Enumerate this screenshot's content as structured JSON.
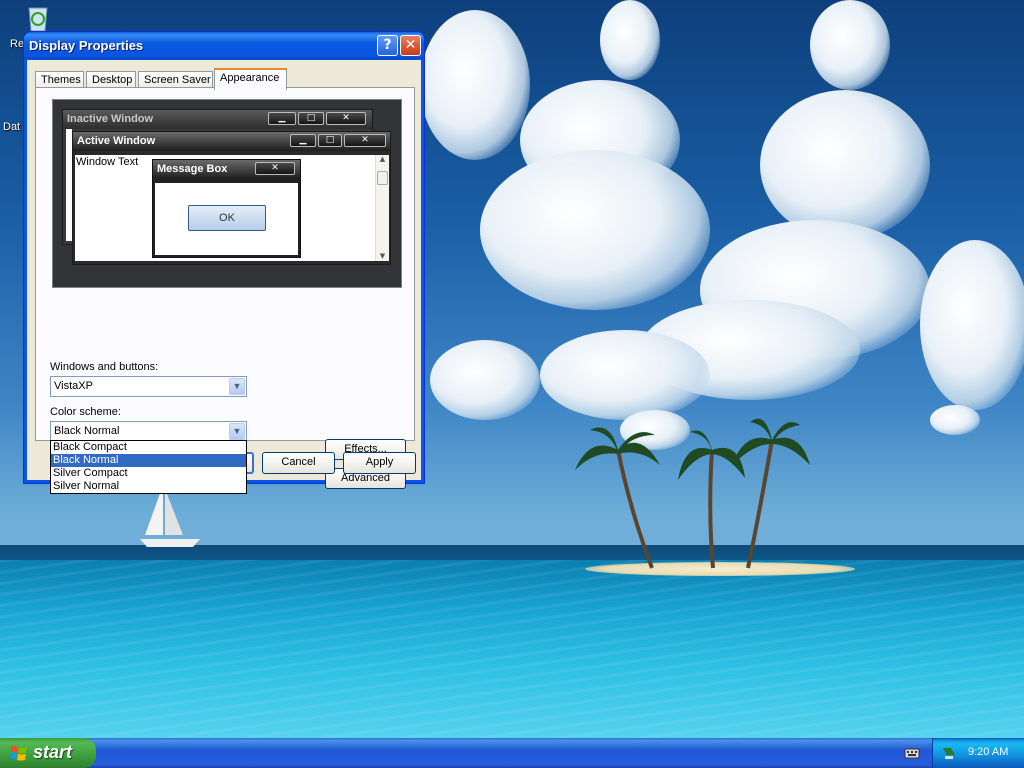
{
  "desktop": {
    "icons": [
      {
        "label": "Re"
      },
      {
        "label": "Dat"
      }
    ]
  },
  "window": {
    "title": "Display Properties",
    "help_glyph": "?",
    "close_glyph": "✕",
    "tabs": [
      {
        "label": "Themes"
      },
      {
        "label": "Desktop"
      },
      {
        "label": "Screen Saver"
      },
      {
        "label": "Appearance"
      }
    ],
    "active_tab": "Appearance",
    "preview": {
      "inactive_title": "Inactive Window",
      "active_title": "Active Window",
      "window_text": "Window Text",
      "message_title": "Message Box",
      "ok_label": "OK",
      "min_glyph": "▁",
      "max_glyph": "□",
      "close_glyph": "✕",
      "scroll_up": "▲",
      "scroll_down": "▼"
    },
    "windows_buttons_label": "Windows and buttons:",
    "windows_buttons_value": "VistaXP",
    "color_scheme_label": "Color scheme:",
    "color_scheme_value": "Black Normal",
    "color_scheme_options": [
      "Black Compact",
      "Black Normal",
      "Silver Compact",
      "Silver Normal"
    ],
    "color_scheme_selected_index": 1,
    "effects_label": "Effects...",
    "advanced_label": "Advanced",
    "ok_label": "OK",
    "cancel_label": "Cancel",
    "apply_label": "Apply",
    "combo_arrow": "▼"
  },
  "taskbar": {
    "start_label": "start",
    "clock": "9:20 AM"
  },
  "colors": {
    "titlebar": "#0a55e3",
    "dialog_bg": "#ece9d8",
    "selection": "#316ac5",
    "start_green": "#3d9d3d",
    "taskbar_blue": "#245edb"
  }
}
